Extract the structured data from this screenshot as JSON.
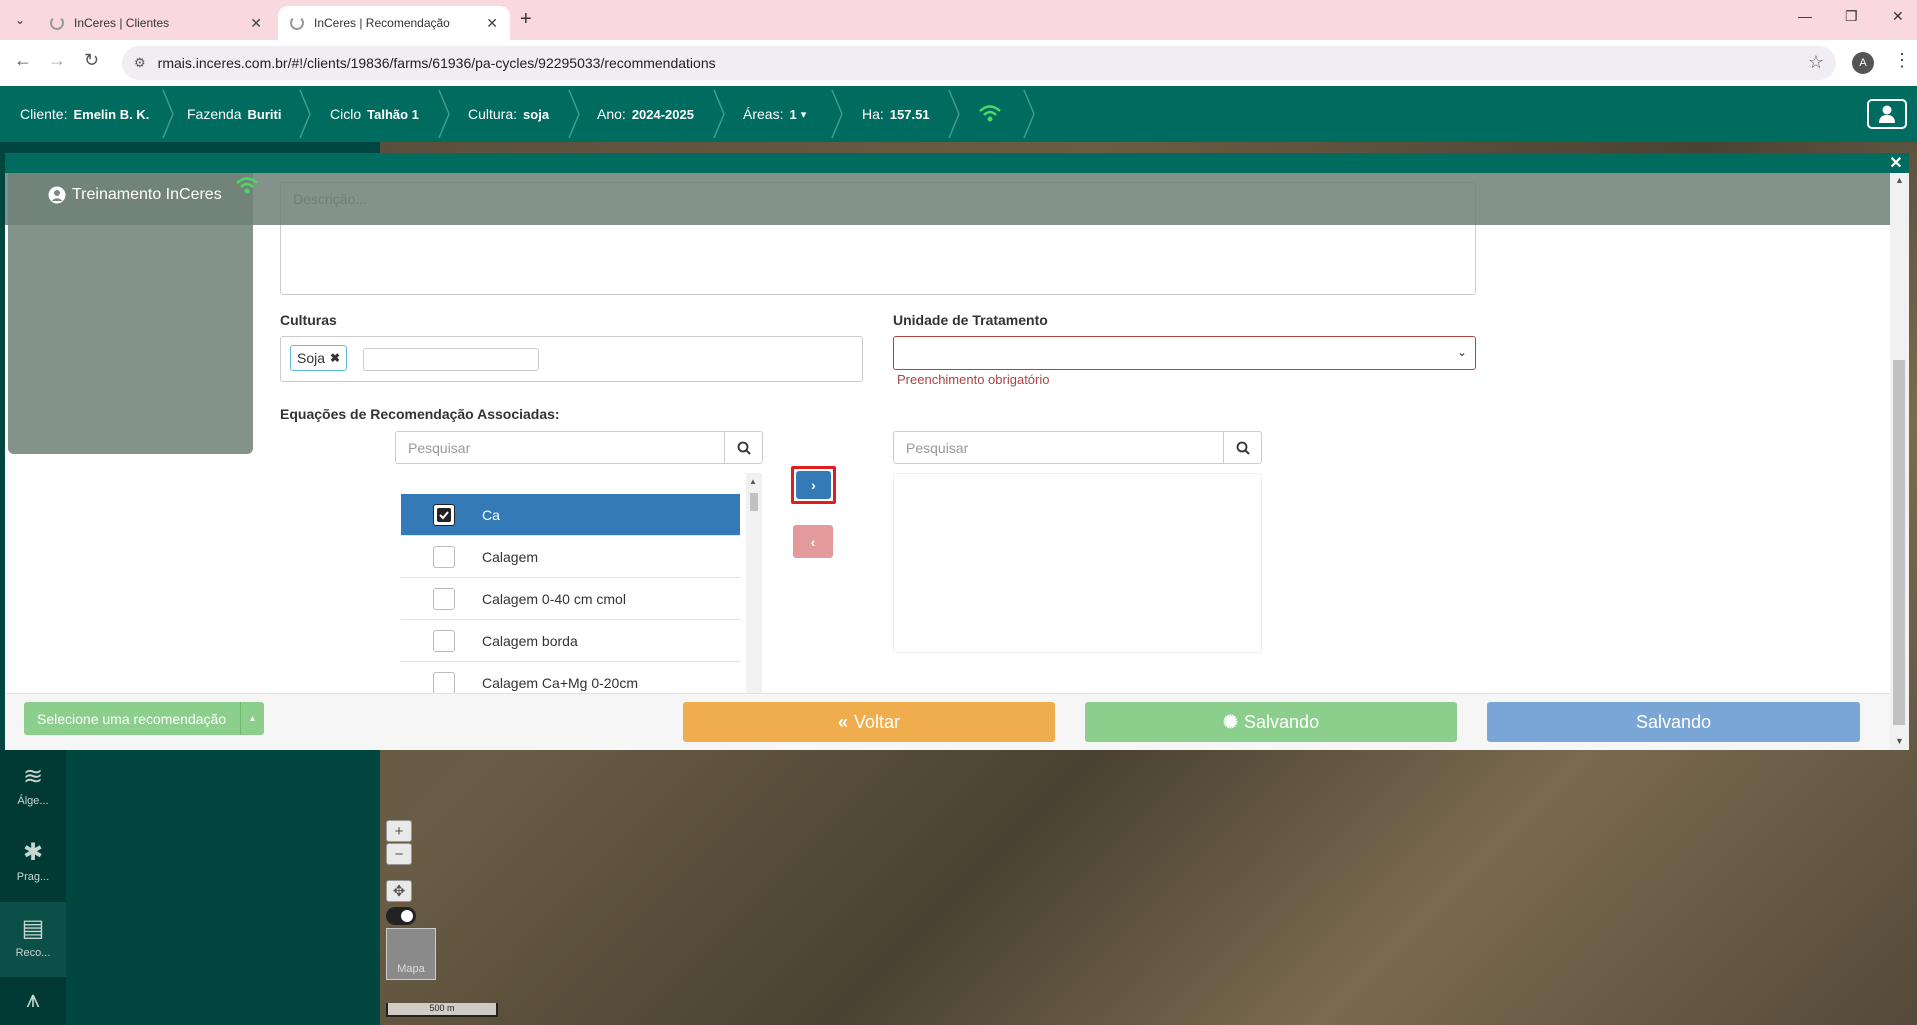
{
  "browser": {
    "tabs": [
      {
        "title": "InCeres | Clientes",
        "active": false
      },
      {
        "title": "InCeres | Recomendação",
        "active": true
      }
    ],
    "url": "rmais.inceres.com.br/#!/clients/19836/farms/61936/pa-cycles/92295033/recommendations",
    "profile_initial": "A"
  },
  "header": {
    "cliente_label": "Cliente:",
    "cliente_value": "Emelin B. K.",
    "fazenda_label": "Fazenda",
    "fazenda_value": "Buriti",
    "ciclo_label": "Ciclo",
    "ciclo_value": "Talhão 1",
    "cultura_label": "Cultura:",
    "cultura_value": "soja",
    "ano_label": "Ano:",
    "ano_value": "2024-2025",
    "areas_label": "Áreas:",
    "areas_value": "1",
    "ha_label": "Ha:",
    "ha_value": "157.51",
    "accent_color": "#006b5f",
    "wifi_color": "#4cd964"
  },
  "card": {
    "user_name": "Treinamento InCeres"
  },
  "form": {
    "description_placeholder": "Descrição...",
    "culturas_label": "Culturas",
    "culturas_tag": "Soja",
    "unidade_label": "Unidade de Tratamento",
    "unidade_error": "Preenchimento obrigatório",
    "equacoes_label": "Equações de Recomendação Associadas:",
    "search_left_placeholder": "Pesquisar",
    "search_right_placeholder": "Pesquisar",
    "list_items": [
      {
        "label": "Ca",
        "checked": true,
        "selected": true
      },
      {
        "label": "Calagem",
        "checked": false,
        "selected": false
      },
      {
        "label": "Calagem 0-40 cm cmol",
        "checked": false,
        "selected": false
      },
      {
        "label": "Calagem borda",
        "checked": false,
        "selected": false
      },
      {
        "label": "Calagem Ca+Mg 0-20cm",
        "checked": false,
        "selected": false
      }
    ]
  },
  "footer": {
    "select_label": "Selecione uma recomendação",
    "voltar_label": "Voltar",
    "salvando1_label": "Salvando",
    "salvando2_label": "Salvando",
    "voltar_color": "#f0ad4e",
    "salvando1_color": "#8ccf8c",
    "salvando2_color": "#7aa6d6"
  },
  "sidebar": {
    "items": [
      {
        "label": "Álge...",
        "icon": "layers-icon"
      },
      {
        "label": "Prag...",
        "icon": "bug-icon"
      },
      {
        "label": "Reco...",
        "icon": "clipboard-icon"
      },
      {
        "label": "",
        "icon": "sprayer-icon"
      }
    ]
  },
  "map": {
    "thumb_label": "Mapa",
    "scale_label": "500 m"
  }
}
